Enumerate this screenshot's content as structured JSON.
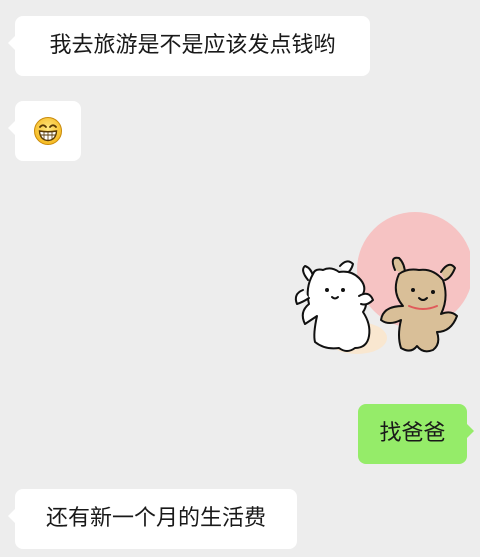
{
  "messages": [
    {
      "side": "left",
      "type": "text",
      "text": "我去旅游是不是应该发点钱哟"
    },
    {
      "side": "left",
      "type": "emoji",
      "emoji": "😁",
      "icon": "grinning-face-icon"
    },
    {
      "side": "right",
      "type": "sticker",
      "icon": "two-bears-dancing-sticker"
    },
    {
      "side": "right",
      "type": "text",
      "text": "找爸爸"
    },
    {
      "side": "left",
      "type": "text",
      "text": "还有新一个月的生活费"
    }
  ],
  "colors": {
    "background": "#ededed",
    "incoming_bubble": "#ffffff",
    "outgoing_bubble": "#95ec69",
    "text": "#191919",
    "sticker_circle": "#f8b8b8",
    "bear_brown": "#d9bf98"
  }
}
